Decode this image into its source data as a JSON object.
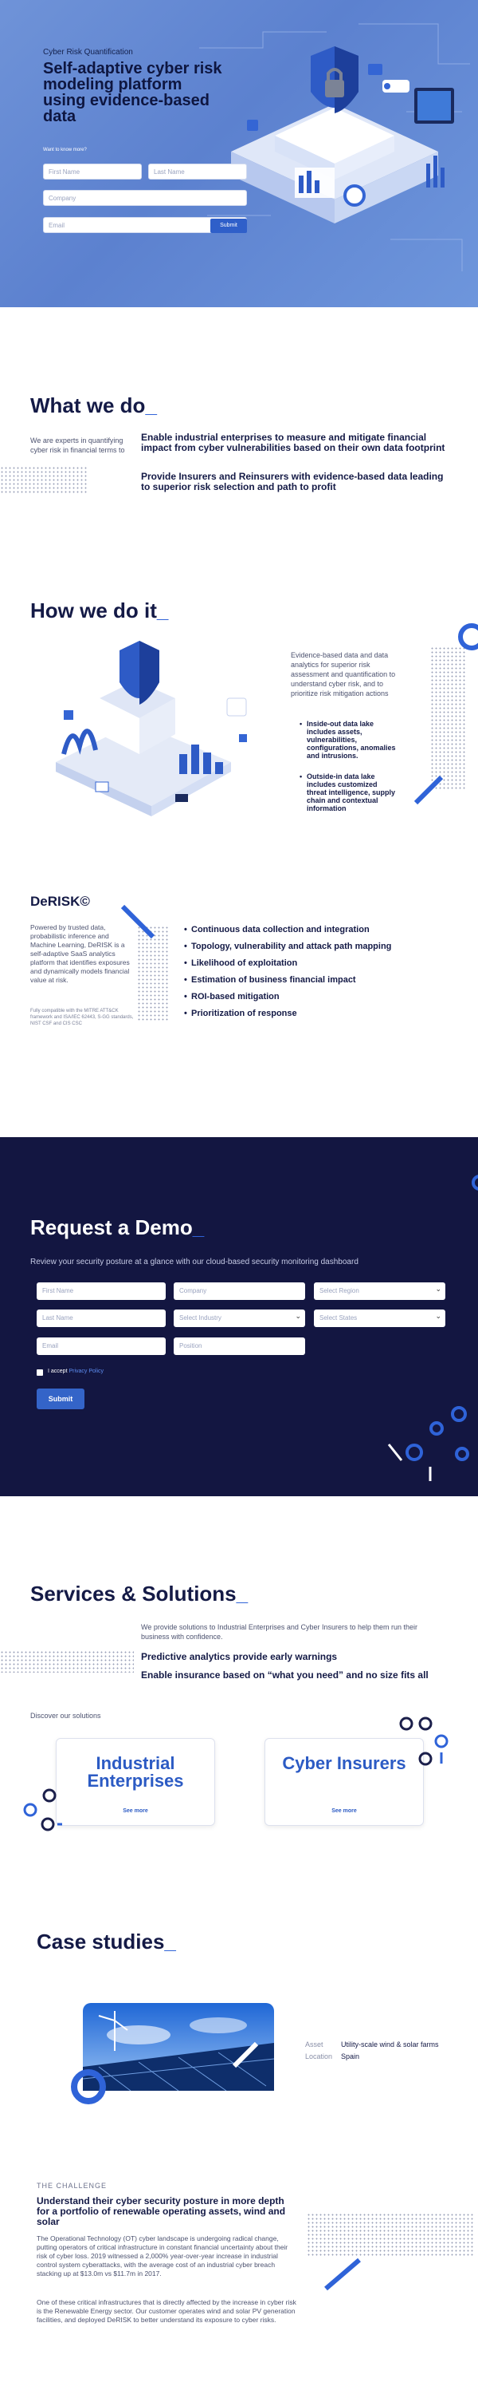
{
  "hero": {
    "eyebrow": "Cyber Risk Quantification",
    "title": "Self-adaptive cyber risk modeling platform using evidence-based data",
    "know_more": "Want to know more?",
    "first_name_placeholder": "First Name",
    "last_name_placeholder": "Last Name",
    "company_placeholder": "Company",
    "email_placeholder": "Email",
    "submit_label": "Submit"
  },
  "what": {
    "title": "What we do",
    "intro": "We are experts in quantifying cyber risk in financial terms to",
    "point1": "Enable industrial enterprises to measure and mitigate financial impact from cyber vulnerabilities based on their own data footprint",
    "point2": "Provide Insurers and Reinsurers with evidence-based data leading to superior risk selection and path to profit"
  },
  "how": {
    "title": "How we do it",
    "intro": "Evidence-based data and data analytics for superior risk assessment and quantification to understand cyber risk, and to prioritize risk mitigation actions",
    "bullets": [
      "Inside-out data lake includes assets, vulnerabilities, configurations, anomalies and intrusions.",
      "Outside-in data lake includes customized threat intelligence, supply chain and contextual information"
    ]
  },
  "derisk": {
    "title": "DeRISK©",
    "description": "Powered by trusted data, probabilistic inference and Machine Learning, DeRISK is a self-adaptive SaaS analytics platform that identifies exposures and dynamically models financial value at risk.",
    "compat": "Fully compatible with the MITRE ATT&CK framework and ISA/IEC 62443, S-GG standards, NIST CSF and CIS CSC",
    "features": [
      "Continuous data collection and integration",
      "Topology, vulnerability and attack path mapping",
      "Likelihood of exploitation",
      "Estimation of business financial impact",
      "ROI-based mitigation",
      "Prioritization of response"
    ]
  },
  "demo": {
    "title": "Request a Demo",
    "subtitle": "Review your security posture at a glance with our cloud-based security monitoring dashboard",
    "first_name": "First Name",
    "company": "Company",
    "region": "Select Region",
    "last_name": "Last Name",
    "industry": "Select Industry",
    "states": "Select States",
    "email": "Email",
    "position": "Position",
    "accept_text": "I accept",
    "privacy_link": "Privacy Policy",
    "submit_label": "Submit"
  },
  "services": {
    "title": "Services & Solutions",
    "intro": "We provide solutions to Industrial Enterprises and Cyber Insurers to help them run their business with confidence.",
    "point1": "Predictive analytics provide early warnings",
    "point2": "Enable insurance based on “what you need” and no size fits all",
    "discover": "Discover our solutions",
    "cards": [
      {
        "title": "Industrial Enterprises",
        "more": "See more"
      },
      {
        "title": "Cyber Insurers",
        "more": "See more"
      }
    ]
  },
  "cases": {
    "title": "Case studies",
    "asset_label": "Asset",
    "asset_value": "Utility-scale wind & solar farms",
    "location_label": "Location",
    "location_value": "Spain",
    "challenge_label": "THE CHALLENGE",
    "challenge_title": "Understand their cyber security posture in more depth for a portfolio of renewable operating assets, wind and solar",
    "para1": "The Operational Technology (OT) cyber landscape is undergoing radical change, putting operators of critical infrastructure in constant financial uncertainty about their risk of cyber loss. 2019 witnessed a 2,000% year-over-year increase in industrial control system cyberattacks, with the average cost of an industrial cyber breach stacking up at $13.0m vs $11.7m in 2017.",
    "para2": "One of these critical infrastructures that is directly affected by the increase in cyber risk is the Renewable Energy sector. Our customer operates wind and solar PV generation facilities, and deployed DeRISK to better understand its exposure to cyber risks."
  },
  "colors": {
    "accent": "#2f63d8",
    "dark_navy": "#131641",
    "hero_blue": "#6f93d8"
  }
}
